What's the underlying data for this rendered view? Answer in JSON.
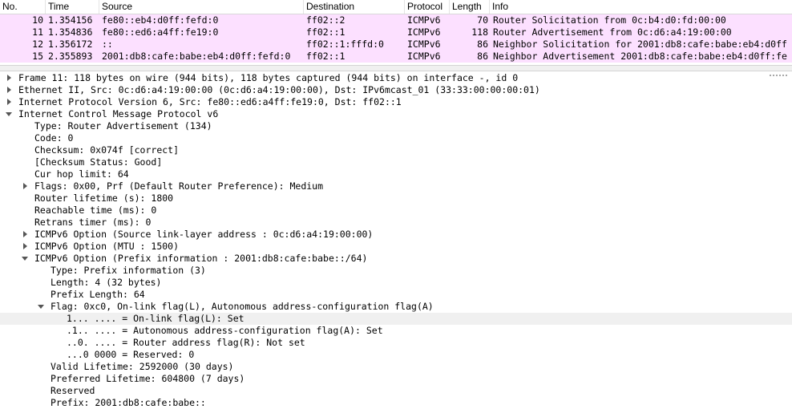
{
  "packet_list": {
    "columns": [
      "No.",
      "Time",
      "Source",
      "Destination",
      "Protocol",
      "Length",
      "Info"
    ],
    "rows": [
      {
        "no": "10",
        "time": "1.354156",
        "src": "fe80::eb4:d0ff:fefd:0",
        "dst": "ff02::2",
        "proto": "ICMPv6",
        "len": "70",
        "info": "Router Solicitation from 0c:b4:d0:fd:00:00"
      },
      {
        "no": "11",
        "time": "1.354836",
        "src": "fe80::ed6:a4ff:fe19:0",
        "dst": "ff02::1",
        "proto": "ICMPv6",
        "len": "118",
        "info": "Router Advertisement from 0c:d6:a4:19:00:00"
      },
      {
        "no": "12",
        "time": "1.356172",
        "src": "::",
        "dst": "ff02::1:fffd:0",
        "proto": "ICMPv6",
        "len": "86",
        "info": "Neighbor Solicitation for 2001:db8:cafe:babe:eb4:d0ff"
      },
      {
        "no": "15",
        "time": "2.355893",
        "src": "2001:db8:cafe:babe:eb4:d0ff:fefd:0",
        "dst": "ff02::1",
        "proto": "ICMPv6",
        "len": "86",
        "info": "Neighbor Advertisement 2001:db8:cafe:babe:eb4:d0ff:fe"
      }
    ]
  },
  "details": [
    {
      "level": 0,
      "expander": "collapsed",
      "text": "Frame 11: 118 bytes on wire (944 bits), 118 bytes captured (944 bits) on interface -, id 0"
    },
    {
      "level": 0,
      "expander": "collapsed",
      "text": "Ethernet II, Src: 0c:d6:a4:19:00:00 (0c:d6:a4:19:00:00), Dst: IPv6mcast_01 (33:33:00:00:00:01)"
    },
    {
      "level": 0,
      "expander": "collapsed",
      "text": "Internet Protocol Version 6, Src: fe80::ed6:a4ff:fe19:0, Dst: ff02::1"
    },
    {
      "level": 0,
      "expander": "expanded",
      "text": "Internet Control Message Protocol v6"
    },
    {
      "level": 1,
      "expander": "none",
      "text": "Type: Router Advertisement (134)"
    },
    {
      "level": 1,
      "expander": "none",
      "text": "Code: 0"
    },
    {
      "level": 1,
      "expander": "none",
      "text": "Checksum: 0x074f [correct]"
    },
    {
      "level": 1,
      "expander": "none",
      "text": "[Checksum Status: Good]"
    },
    {
      "level": 1,
      "expander": "none",
      "text": "Cur hop limit: 64"
    },
    {
      "level": 1,
      "expander": "collapsed",
      "text": "Flags: 0x00, Prf (Default Router Preference): Medium"
    },
    {
      "level": 1,
      "expander": "none",
      "text": "Router lifetime (s): 1800"
    },
    {
      "level": 1,
      "expander": "none",
      "text": "Reachable time (ms): 0"
    },
    {
      "level": 1,
      "expander": "none",
      "text": "Retrans timer (ms): 0"
    },
    {
      "level": 1,
      "expander": "collapsed",
      "text": "ICMPv6 Option (Source link-layer address : 0c:d6:a4:19:00:00)"
    },
    {
      "level": 1,
      "expander": "collapsed",
      "text": "ICMPv6 Option (MTU : 1500)"
    },
    {
      "level": 1,
      "expander": "expanded",
      "text": "ICMPv6 Option (Prefix information : 2001:db8:cafe:babe::/64)"
    },
    {
      "level": 2,
      "expander": "none",
      "text": "Type: Prefix information (3)"
    },
    {
      "level": 2,
      "expander": "none",
      "text": "Length: 4 (32 bytes)"
    },
    {
      "level": 2,
      "expander": "none",
      "text": "Prefix Length: 64"
    },
    {
      "level": 2,
      "expander": "expanded",
      "text": "Flag: 0xc0, On-link flag(L), Autonomous address-configuration flag(A)"
    },
    {
      "level": 3,
      "expander": "none",
      "text": "1... .... = On-link flag(L): Set",
      "highlighted": true
    },
    {
      "level": 3,
      "expander": "none",
      "text": ".1.. .... = Autonomous address-configuration flag(A): Set"
    },
    {
      "level": 3,
      "expander": "none",
      "text": "..0. .... = Router address flag(R): Not set"
    },
    {
      "level": 3,
      "expander": "none",
      "text": "...0 0000 = Reserved: 0"
    },
    {
      "level": 2,
      "expander": "none",
      "text": "Valid Lifetime: 2592000 (30 days)"
    },
    {
      "level": 2,
      "expander": "none",
      "text": "Preferred Lifetime: 604800 (7 days)"
    },
    {
      "level": 2,
      "expander": "none",
      "text": "Reserved"
    },
    {
      "level": 2,
      "expander": "none",
      "text": "Prefix: 2001:db8:cafe:babe::"
    }
  ],
  "colors": {
    "row_icmpv6": "#fce0ff",
    "highlight": "#f0f0f0"
  }
}
